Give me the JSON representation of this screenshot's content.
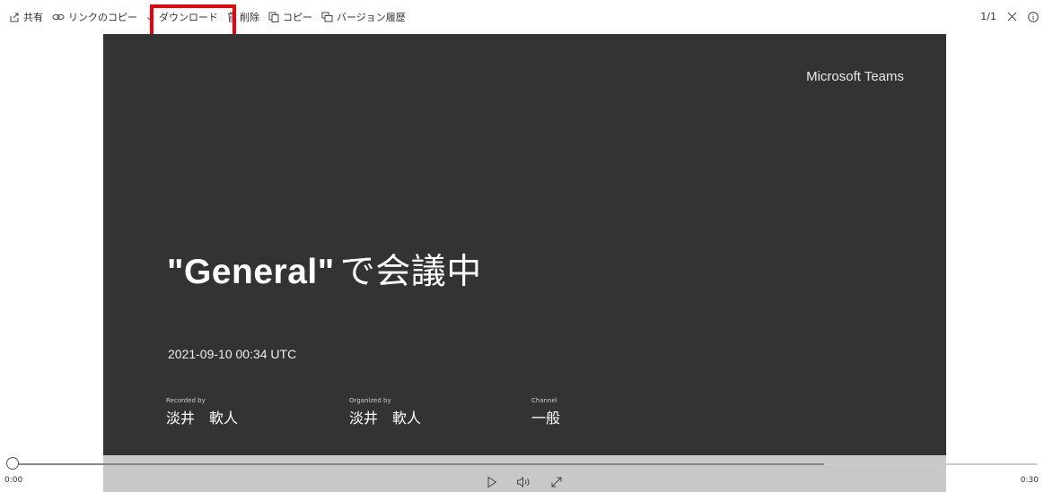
{
  "toolbar": {
    "share_label": "共有",
    "copy_link_label": "リンクのコピー",
    "download_label": "ダウンロード",
    "delete_label": "削除",
    "copy_label": "コピー",
    "version_history_label": "バージョン履歴",
    "highlight_color": "#e8000b"
  },
  "page_indicator": "1/1",
  "video": {
    "brand": "Microsoft Teams",
    "title_quoted": "\"General\"",
    "title_rest": "で会議中",
    "datetime": "2021-09-10 00:34 UTC",
    "recorded_by_caption": "Recorded by",
    "recorded_by": "淡井　軟人",
    "organized_by_caption": "Organized by",
    "organized_by": "淡井　軟人",
    "channel_caption": "Channel",
    "channel": "一般"
  },
  "player": {
    "current_time": "0:00",
    "duration": "0:30",
    "progress": 0.0,
    "icons": [
      "play-icon",
      "volume-icon",
      "fullscreen-icon"
    ]
  }
}
